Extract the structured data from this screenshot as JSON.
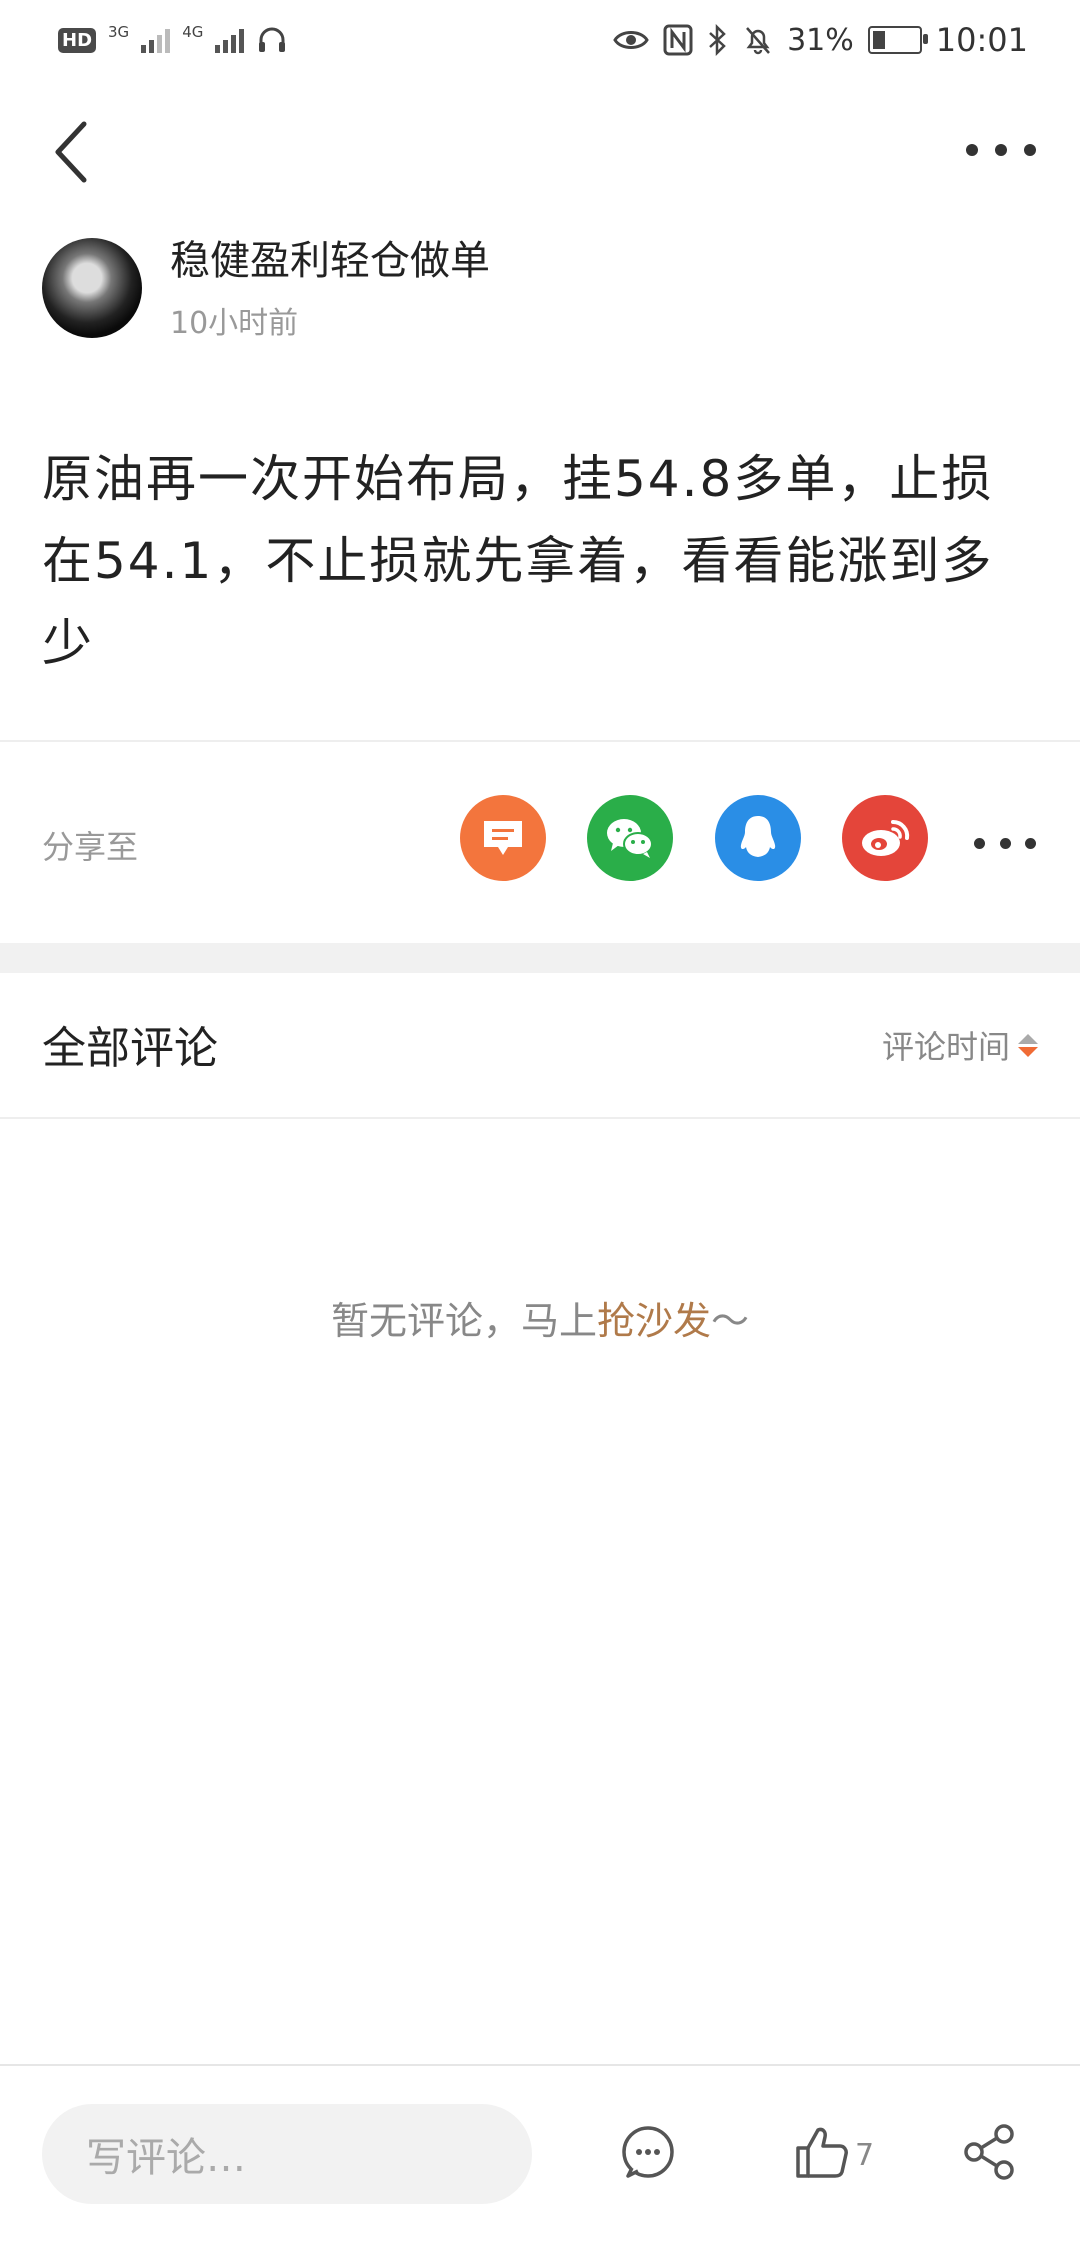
{
  "status_bar": {
    "hd": "HD",
    "net1": "3G",
    "net2": "4G",
    "battery_pct": "31%",
    "time": "10:01"
  },
  "author": {
    "name": "稳健盈利轻仓做单",
    "time": "10小时前"
  },
  "post": {
    "content": "原油再一次开始布局，挂54.8多单，止损在54.1，不止损就先拿着，看看能涨到多少"
  },
  "share": {
    "label": "分享至",
    "targets": [
      "message-icon",
      "wechat-icon",
      "qq-icon",
      "weibo-icon"
    ],
    "colors": {
      "message": "#f3753d",
      "wechat": "#2aae49",
      "qq": "#2a8ee6",
      "weibo": "#e4453a"
    }
  },
  "comments": {
    "title": "全部评论",
    "sort_label": "评论时间",
    "empty_prefix": "暂无评论，马上",
    "empty_link": "抢沙发",
    "empty_suffix": "～"
  },
  "bottom_bar": {
    "input_placeholder": "写评论…",
    "like_count": "7"
  }
}
